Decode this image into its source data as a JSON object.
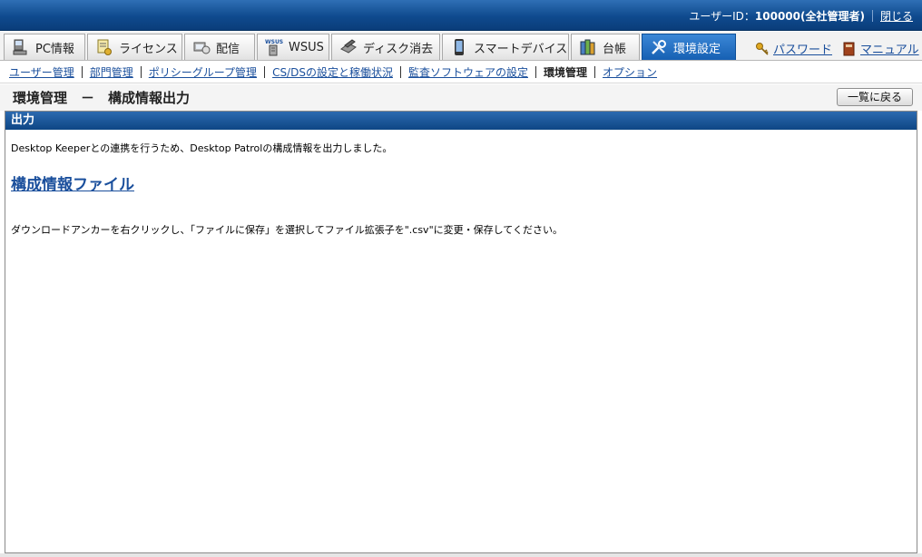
{
  "header": {
    "user_label": "ユーザーID：",
    "user_id": "100000(全社管理者)",
    "close_label": "閉じる"
  },
  "tabs": [
    {
      "label": "PC情報",
      "icon": "pc-info-icon"
    },
    {
      "label": "ライセンス",
      "icon": "license-icon"
    },
    {
      "label": "配信",
      "icon": "delivery-icon"
    },
    {
      "label": "WSUS",
      "icon": "wsus-icon",
      "badge": "WSUS"
    },
    {
      "label": "ディスク消去",
      "icon": "disk-erase-icon"
    },
    {
      "label": "スマートデバイス",
      "icon": "smart-device-icon"
    },
    {
      "label": "台帳",
      "icon": "ledger-icon"
    },
    {
      "label": "環境設定",
      "icon": "settings-tools-icon",
      "active": true
    }
  ],
  "top_links": {
    "password": "パスワード",
    "manual": "マニュアル"
  },
  "subnav": {
    "items": [
      "ユーザー管理",
      "部門管理",
      "ポリシーグループ管理",
      "CS/DSの設定と稼働状況",
      "監査ソフトウェアの設定"
    ],
    "current": "環境管理",
    "last": "オプション"
  },
  "page": {
    "title": "環境管理　－　構成情報出力",
    "back_button": "一覧に戻る"
  },
  "panel": {
    "heading": "出力",
    "message": "Desktop Keeperとの連携を行うため、Desktop Patrolの構成情報を出力しました。",
    "file_link": "構成情報ファイル",
    "note": "ダウンロードアンカーを右クリックし、「ファイルに保存」を選択してファイル拡張子を\".csv\"に変更・保存してください。"
  },
  "colors": {
    "header_bg": "#0f4a8e",
    "active_tab": "#1660b3",
    "link": "#1a4f9c"
  }
}
